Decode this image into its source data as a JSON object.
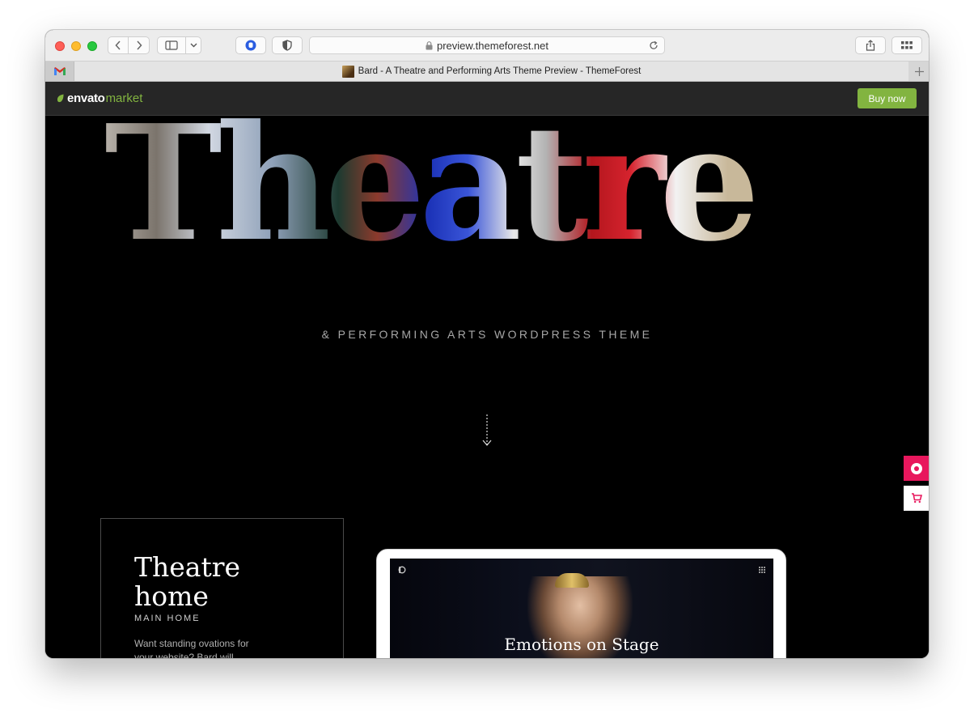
{
  "browser": {
    "url": "preview.themeforest.net",
    "tab_title": "Bard - A Theatre and Performing Arts Theme Preview - ThemeForest",
    "pinned_tab": "M"
  },
  "envato": {
    "logo_part1": "envato",
    "logo_part2": "market",
    "buy_label": "Buy now",
    "accent": "#82b440"
  },
  "hero": {
    "title": "Theatre",
    "subtitle": "& PERFORMING ARTS WORDPRESS THEME"
  },
  "card": {
    "title": "Theatre home",
    "subtitle": "MAIN HOME",
    "desc": "Want standing ovations for your website? Bard will"
  },
  "preview": {
    "caption": "Emotions on Stage"
  },
  "side_buttons": {
    "accent": "#e8175d"
  }
}
